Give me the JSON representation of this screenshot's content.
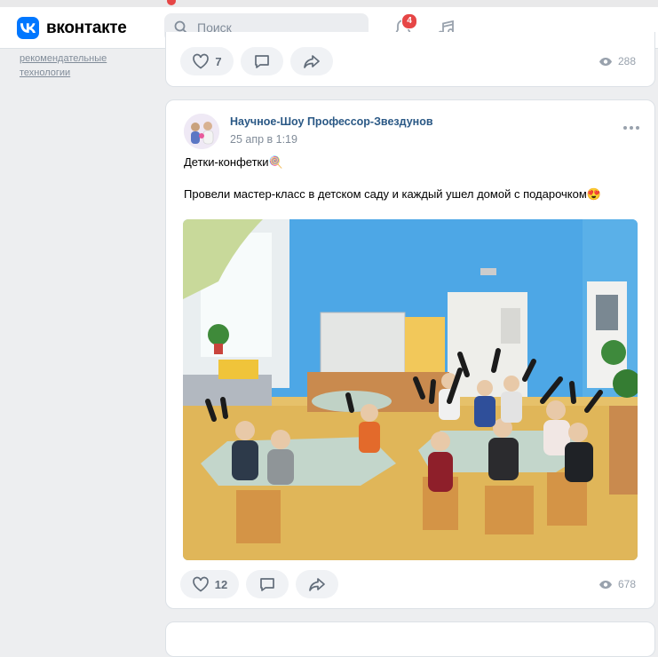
{
  "header": {
    "logo_text": "вконтакте",
    "search_placeholder": "Поиск",
    "notifications_count": "4"
  },
  "sidebar": {
    "links": [
      "рекомендательные",
      "технологии"
    ]
  },
  "post_prev": {
    "likes": "7",
    "views": "288"
  },
  "post": {
    "author": "Научное-Шоу Профессор-Звездунов",
    "date": "25 апр в 1:19",
    "title_line": "Детки-конфетки🍭",
    "body_line": "Провели мастер-класс в детском саду и каждый ушел домой с подарочком😍",
    "likes": "12",
    "views": "678",
    "photo_description_icon": "classroom-photo"
  },
  "colors": {
    "accent": "#0077ff",
    "link": "#2a5885",
    "badge": "#e64646",
    "background": "#edeef0"
  }
}
